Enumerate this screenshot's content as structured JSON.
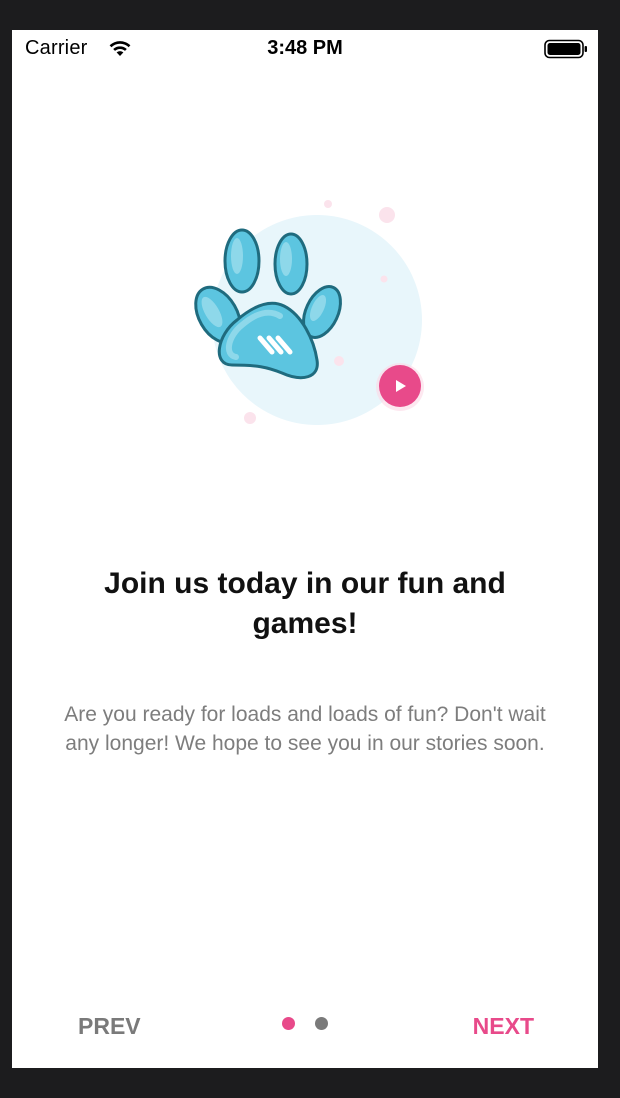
{
  "status_bar": {
    "carrier": "Carrier",
    "time": "3:48 PM",
    "wifi_icon": "wifi-icon",
    "battery_icon": "battery-icon"
  },
  "illustration": {
    "icon": "paw-icon",
    "badge_icon": "play-icon",
    "colors": {
      "paw": "#5cc5e0",
      "paw_stroke": "#1f6b7e",
      "circle": "#e8f6fb",
      "accent": "#e84a8a"
    }
  },
  "content": {
    "headline": "Join us today in our fun and games!",
    "body": "Are you ready for loads and loads of fun? Don't wait any longer! We hope to see you in our stories soon."
  },
  "navigation": {
    "prev_label": "PREV",
    "next_label": "NEXT",
    "pages": 2,
    "current_page": 1,
    "active_color": "#e84a8a",
    "inactive_color": "#7a7a7a"
  }
}
